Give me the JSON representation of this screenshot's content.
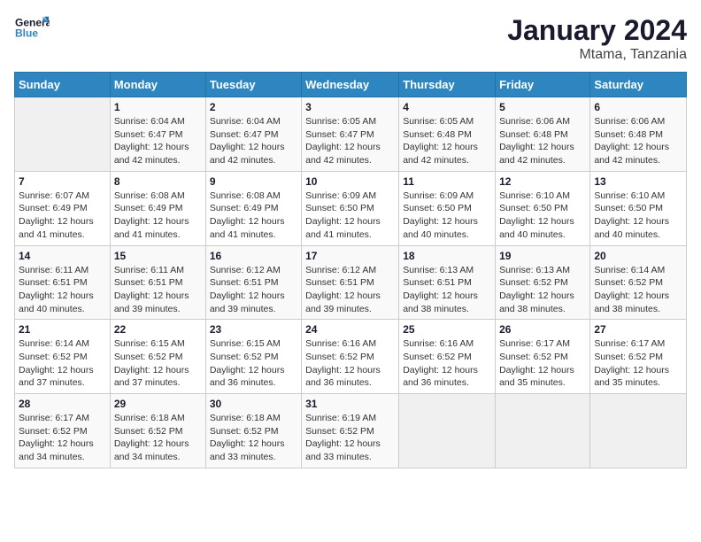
{
  "header": {
    "logo_general": "General",
    "logo_blue": "Blue",
    "title": "January 2024",
    "subtitle": "Mtama, Tanzania"
  },
  "days_of_week": [
    "Sunday",
    "Monday",
    "Tuesday",
    "Wednesday",
    "Thursday",
    "Friday",
    "Saturday"
  ],
  "weeks": [
    [
      {
        "day": "",
        "info": ""
      },
      {
        "day": "1",
        "info": "Sunrise: 6:04 AM\nSunset: 6:47 PM\nDaylight: 12 hours\nand 42 minutes."
      },
      {
        "day": "2",
        "info": "Sunrise: 6:04 AM\nSunset: 6:47 PM\nDaylight: 12 hours\nand 42 minutes."
      },
      {
        "day": "3",
        "info": "Sunrise: 6:05 AM\nSunset: 6:47 PM\nDaylight: 12 hours\nand 42 minutes."
      },
      {
        "day": "4",
        "info": "Sunrise: 6:05 AM\nSunset: 6:48 PM\nDaylight: 12 hours\nand 42 minutes."
      },
      {
        "day": "5",
        "info": "Sunrise: 6:06 AM\nSunset: 6:48 PM\nDaylight: 12 hours\nand 42 minutes."
      },
      {
        "day": "6",
        "info": "Sunrise: 6:06 AM\nSunset: 6:48 PM\nDaylight: 12 hours\nand 42 minutes."
      }
    ],
    [
      {
        "day": "7",
        "info": "Sunrise: 6:07 AM\nSunset: 6:49 PM\nDaylight: 12 hours\nand 41 minutes."
      },
      {
        "day": "8",
        "info": "Sunrise: 6:08 AM\nSunset: 6:49 PM\nDaylight: 12 hours\nand 41 minutes."
      },
      {
        "day": "9",
        "info": "Sunrise: 6:08 AM\nSunset: 6:49 PM\nDaylight: 12 hours\nand 41 minutes."
      },
      {
        "day": "10",
        "info": "Sunrise: 6:09 AM\nSunset: 6:50 PM\nDaylight: 12 hours\nand 41 minutes."
      },
      {
        "day": "11",
        "info": "Sunrise: 6:09 AM\nSunset: 6:50 PM\nDaylight: 12 hours\nand 40 minutes."
      },
      {
        "day": "12",
        "info": "Sunrise: 6:10 AM\nSunset: 6:50 PM\nDaylight: 12 hours\nand 40 minutes."
      },
      {
        "day": "13",
        "info": "Sunrise: 6:10 AM\nSunset: 6:50 PM\nDaylight: 12 hours\nand 40 minutes."
      }
    ],
    [
      {
        "day": "14",
        "info": "Sunrise: 6:11 AM\nSunset: 6:51 PM\nDaylight: 12 hours\nand 40 minutes."
      },
      {
        "day": "15",
        "info": "Sunrise: 6:11 AM\nSunset: 6:51 PM\nDaylight: 12 hours\nand 39 minutes."
      },
      {
        "day": "16",
        "info": "Sunrise: 6:12 AM\nSunset: 6:51 PM\nDaylight: 12 hours\nand 39 minutes."
      },
      {
        "day": "17",
        "info": "Sunrise: 6:12 AM\nSunset: 6:51 PM\nDaylight: 12 hours\nand 39 minutes."
      },
      {
        "day": "18",
        "info": "Sunrise: 6:13 AM\nSunset: 6:51 PM\nDaylight: 12 hours\nand 38 minutes."
      },
      {
        "day": "19",
        "info": "Sunrise: 6:13 AM\nSunset: 6:52 PM\nDaylight: 12 hours\nand 38 minutes."
      },
      {
        "day": "20",
        "info": "Sunrise: 6:14 AM\nSunset: 6:52 PM\nDaylight: 12 hours\nand 38 minutes."
      }
    ],
    [
      {
        "day": "21",
        "info": "Sunrise: 6:14 AM\nSunset: 6:52 PM\nDaylight: 12 hours\nand 37 minutes."
      },
      {
        "day": "22",
        "info": "Sunrise: 6:15 AM\nSunset: 6:52 PM\nDaylight: 12 hours\nand 37 minutes."
      },
      {
        "day": "23",
        "info": "Sunrise: 6:15 AM\nSunset: 6:52 PM\nDaylight: 12 hours\nand 36 minutes."
      },
      {
        "day": "24",
        "info": "Sunrise: 6:16 AM\nSunset: 6:52 PM\nDaylight: 12 hours\nand 36 minutes."
      },
      {
        "day": "25",
        "info": "Sunrise: 6:16 AM\nSunset: 6:52 PM\nDaylight: 12 hours\nand 36 minutes."
      },
      {
        "day": "26",
        "info": "Sunrise: 6:17 AM\nSunset: 6:52 PM\nDaylight: 12 hours\nand 35 minutes."
      },
      {
        "day": "27",
        "info": "Sunrise: 6:17 AM\nSunset: 6:52 PM\nDaylight: 12 hours\nand 35 minutes."
      }
    ],
    [
      {
        "day": "28",
        "info": "Sunrise: 6:17 AM\nSunset: 6:52 PM\nDaylight: 12 hours\nand 34 minutes."
      },
      {
        "day": "29",
        "info": "Sunrise: 6:18 AM\nSunset: 6:52 PM\nDaylight: 12 hours\nand 34 minutes."
      },
      {
        "day": "30",
        "info": "Sunrise: 6:18 AM\nSunset: 6:52 PM\nDaylight: 12 hours\nand 33 minutes."
      },
      {
        "day": "31",
        "info": "Sunrise: 6:19 AM\nSunset: 6:52 PM\nDaylight: 12 hours\nand 33 minutes."
      },
      {
        "day": "",
        "info": ""
      },
      {
        "day": "",
        "info": ""
      },
      {
        "day": "",
        "info": ""
      }
    ]
  ]
}
